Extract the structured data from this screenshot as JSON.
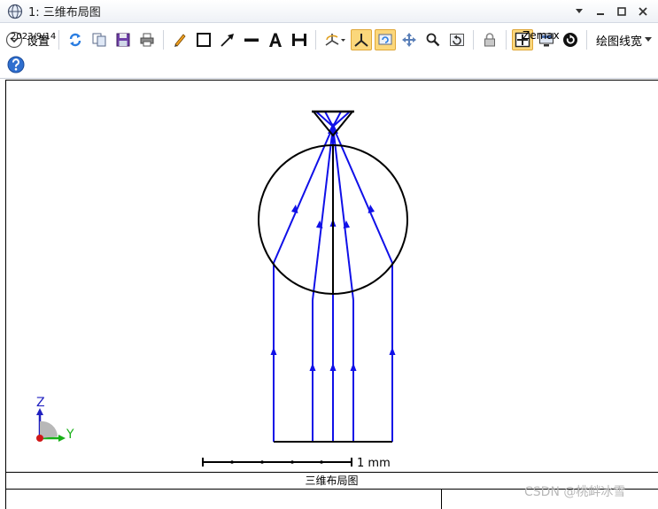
{
  "window": {
    "title": "1: 三维布局图"
  },
  "toolbar": {
    "settings_label": "设置",
    "linewidth_label": "绘图线宽"
  },
  "plot": {
    "scale_label": "1 mm",
    "axis_z_label": "Z",
    "axis_y_label": "Y",
    "colors": {
      "rays": "#1010e8",
      "lens": "#000000",
      "axis_z": "#2020c0",
      "axis_y": "#18b018",
      "origin": "#d01818"
    }
  },
  "info": {
    "title": "三维布局图",
    "date": "2023/9/14",
    "company": "Zemax"
  },
  "watermark": "CSDN @桃衅冰雪"
}
